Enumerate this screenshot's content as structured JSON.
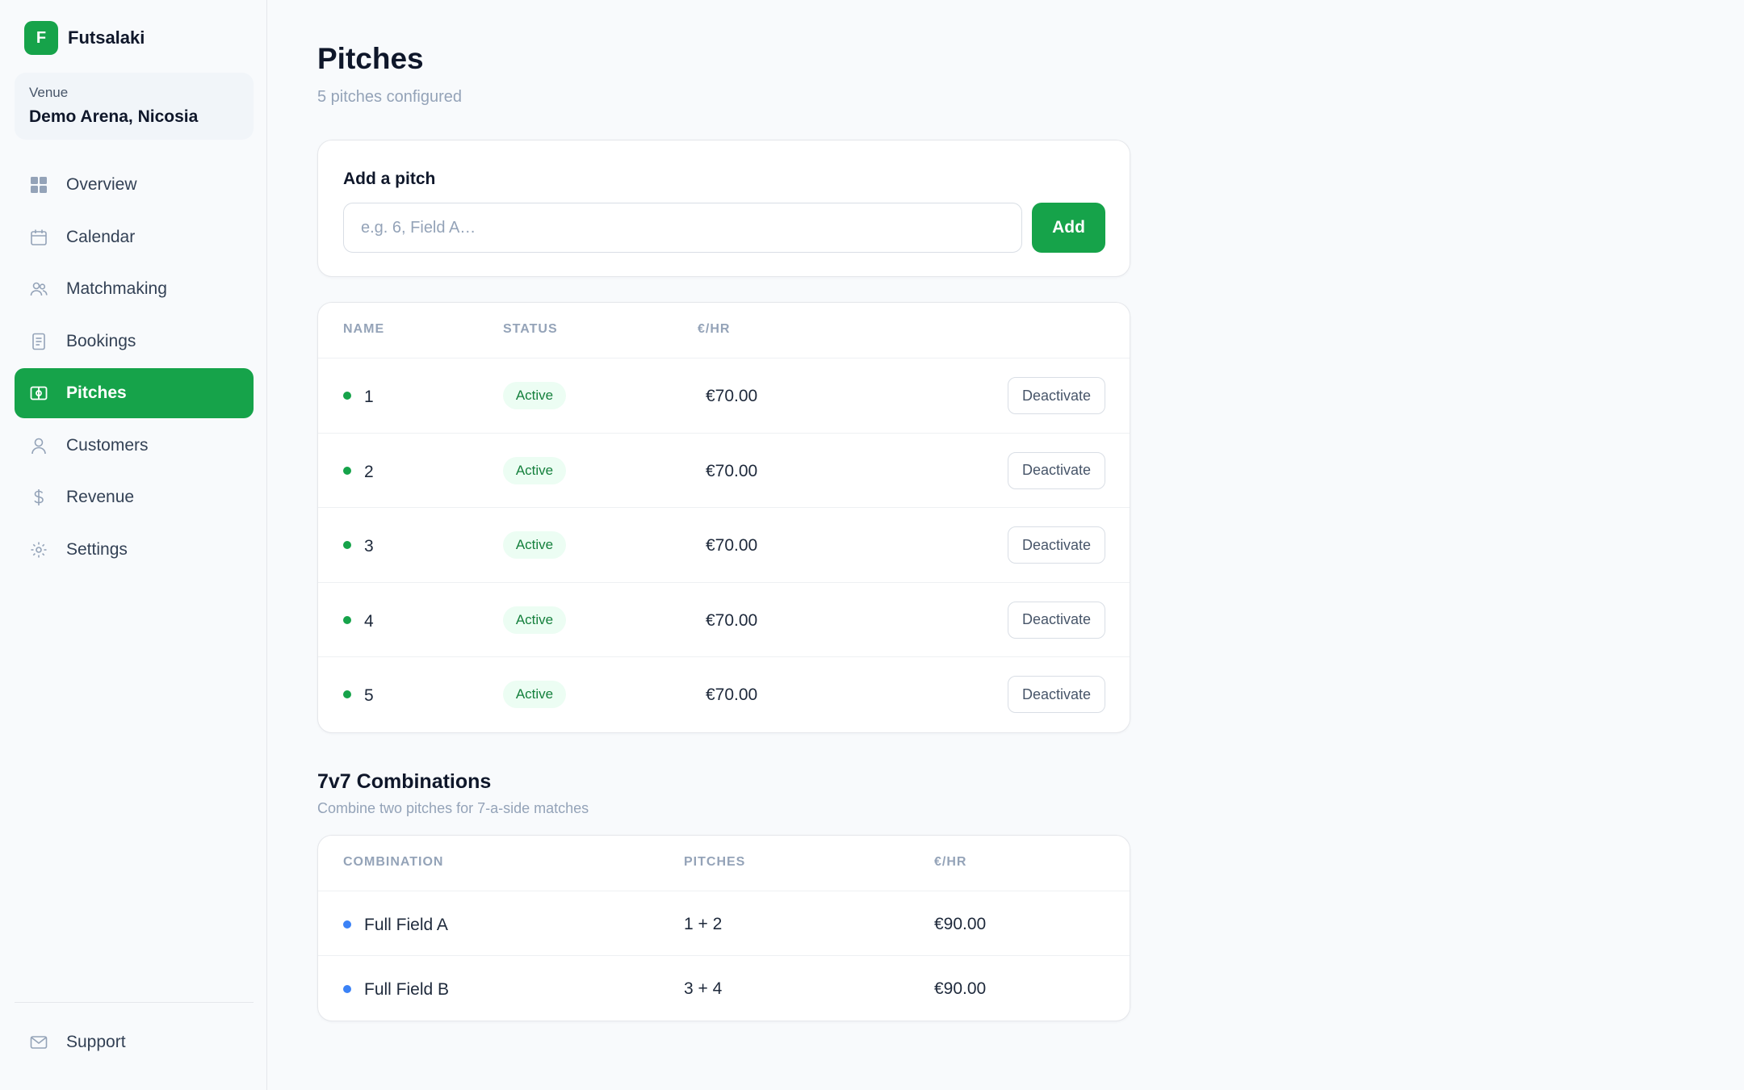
{
  "brand": {
    "logo_letter": "F",
    "name": "Futsalaki",
    "color": "#16a34a"
  },
  "venue": {
    "label": "Venue",
    "name": "Demo Arena, Nicosia"
  },
  "nav": [
    {
      "label": "Overview",
      "icon": "grid-icon",
      "active": false
    },
    {
      "label": "Calendar",
      "icon": "calendar-icon",
      "active": false
    },
    {
      "label": "Matchmaking",
      "icon": "users-icon",
      "active": false
    },
    {
      "label": "Bookings",
      "icon": "document-icon",
      "active": false
    },
    {
      "label": "Pitches",
      "icon": "pitch-icon",
      "active": true
    },
    {
      "label": "Customers",
      "icon": "user-icon",
      "active": false
    },
    {
      "label": "Revenue",
      "icon": "dollar-icon",
      "active": false
    },
    {
      "label": "Settings",
      "icon": "gear-icon",
      "active": false
    }
  ],
  "support": {
    "label": "Support",
    "icon": "mail-icon"
  },
  "page": {
    "title": "Pitches",
    "subtitle": "5 pitches configured"
  },
  "add_pitch": {
    "title": "Add a pitch",
    "placeholder": "e.g. 6, Field A…",
    "value": "",
    "button_label": "Add"
  },
  "pitches_table": {
    "headers": {
      "name": "NAME",
      "status": "STATUS",
      "rate": "€/HR"
    },
    "rows": [
      {
        "name": "1",
        "status": "Active",
        "rate": "€70.00",
        "action": "Deactivate"
      },
      {
        "name": "2",
        "status": "Active",
        "rate": "€70.00",
        "action": "Deactivate"
      },
      {
        "name": "3",
        "status": "Active",
        "rate": "€70.00",
        "action": "Deactivate"
      },
      {
        "name": "4",
        "status": "Active",
        "rate": "€70.00",
        "action": "Deactivate"
      },
      {
        "name": "5",
        "status": "Active",
        "rate": "€70.00",
        "action": "Deactivate"
      }
    ],
    "status_dot_color": "#16a34a"
  },
  "combinations": {
    "title": "7v7 Combinations",
    "subtitle": "Combine two pitches for 7-a-side matches",
    "headers": {
      "combination": "COMBINATION",
      "pitches": "PITCHES",
      "rate": "€/HR"
    },
    "rows": [
      {
        "name": "Full Field A",
        "pitches": "1 + 2",
        "rate": "€90.00"
      },
      {
        "name": "Full Field B",
        "pitches": "3 + 4",
        "rate": "€90.00"
      }
    ],
    "dot_color": "#3b82f6"
  }
}
